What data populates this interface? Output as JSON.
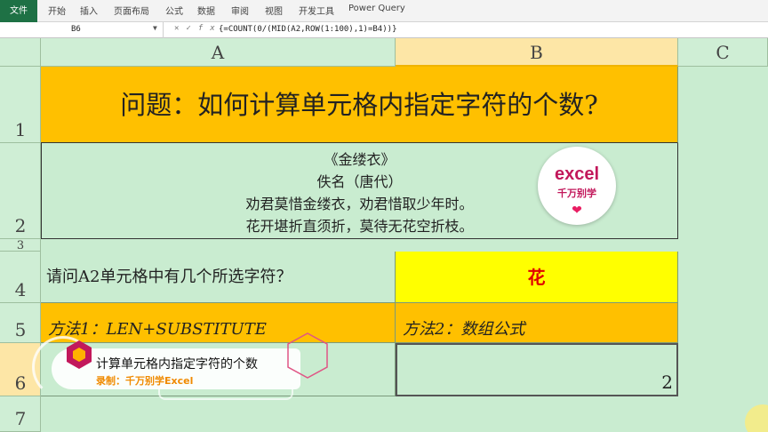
{
  "ribbon": {
    "tabs": [
      "文件",
      "开始",
      "插入",
      "页面布局",
      "公式",
      "数据",
      "审阅",
      "视图",
      "开发工具",
      "Power Query"
    ]
  },
  "formula_bar": {
    "name_box": "B6",
    "formula": "{=COUNT(0/(MID(A2,ROW(1:100),1)=B4))}"
  },
  "columns": [
    "A",
    "B",
    "C"
  ],
  "rows": [
    "1",
    "2",
    "3",
    "4",
    "5",
    "6",
    "7"
  ],
  "cells": {
    "A1": "问题：如何计算单元格内指定字符的个数?",
    "A2": [
      "《金缕衣》",
      "佚名（唐代）",
      "劝君莫惜金缕衣，劝君惜取少年时。",
      "花开堪折直须折，莫待无花空折枝。"
    ],
    "A4": "请问A2单元格中有几个所选字符？",
    "B4": "花",
    "A5": "方法1：LEN+SUBSTITUTE",
    "B5": "方法2：数组公式",
    "B6": "2"
  },
  "logo": {
    "line1": "excel",
    "line2": "千万别学"
  },
  "banner": {
    "title": "计算单元格内指定字符的个数",
    "subtitle": "录制：千万别学Excel"
  },
  "colors": {
    "orange": "#ffc000",
    "yellow": "#ffff00",
    "red_text": "#e00000",
    "sheet_bg": "#c9ecd0",
    "accent": "#c2185b"
  }
}
